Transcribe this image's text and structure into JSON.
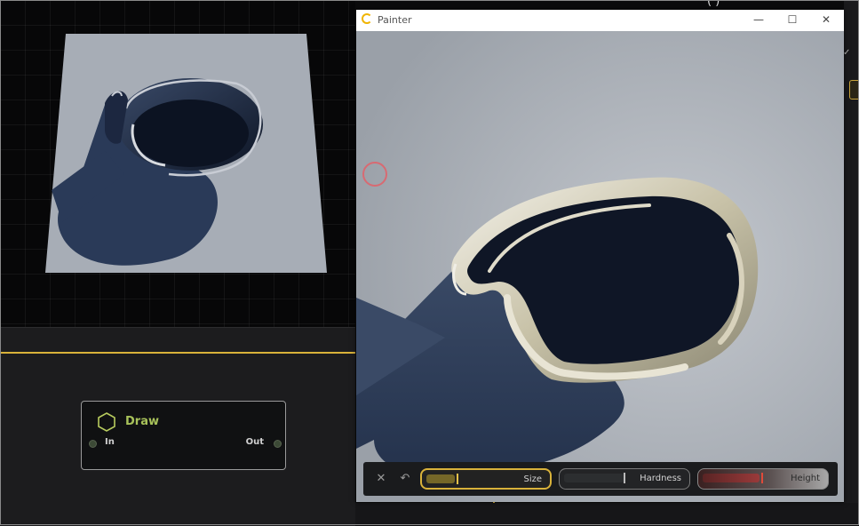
{
  "painter": {
    "title": "Painter",
    "accent_color": "#d9b23a",
    "toolbar": {
      "sliders": [
        {
          "label": "Size",
          "level": 0.25
        },
        {
          "label": "Hardness",
          "level": 0.5
        },
        {
          "label": "Height",
          "level": 0.5
        }
      ]
    }
  },
  "node": {
    "title": "Draw",
    "input_label": "In",
    "output_label": "Out",
    "title_color": "#a8c25a"
  },
  "icons": {
    "app": "painter-app-icon",
    "minimize": "minimize-icon",
    "maximize": "maximize-icon",
    "close": "close-icon",
    "toolbar_close": "close-icon",
    "undo": "undo-icon",
    "node": "hexagon-icon",
    "cursor": "brush-cursor-icon"
  }
}
